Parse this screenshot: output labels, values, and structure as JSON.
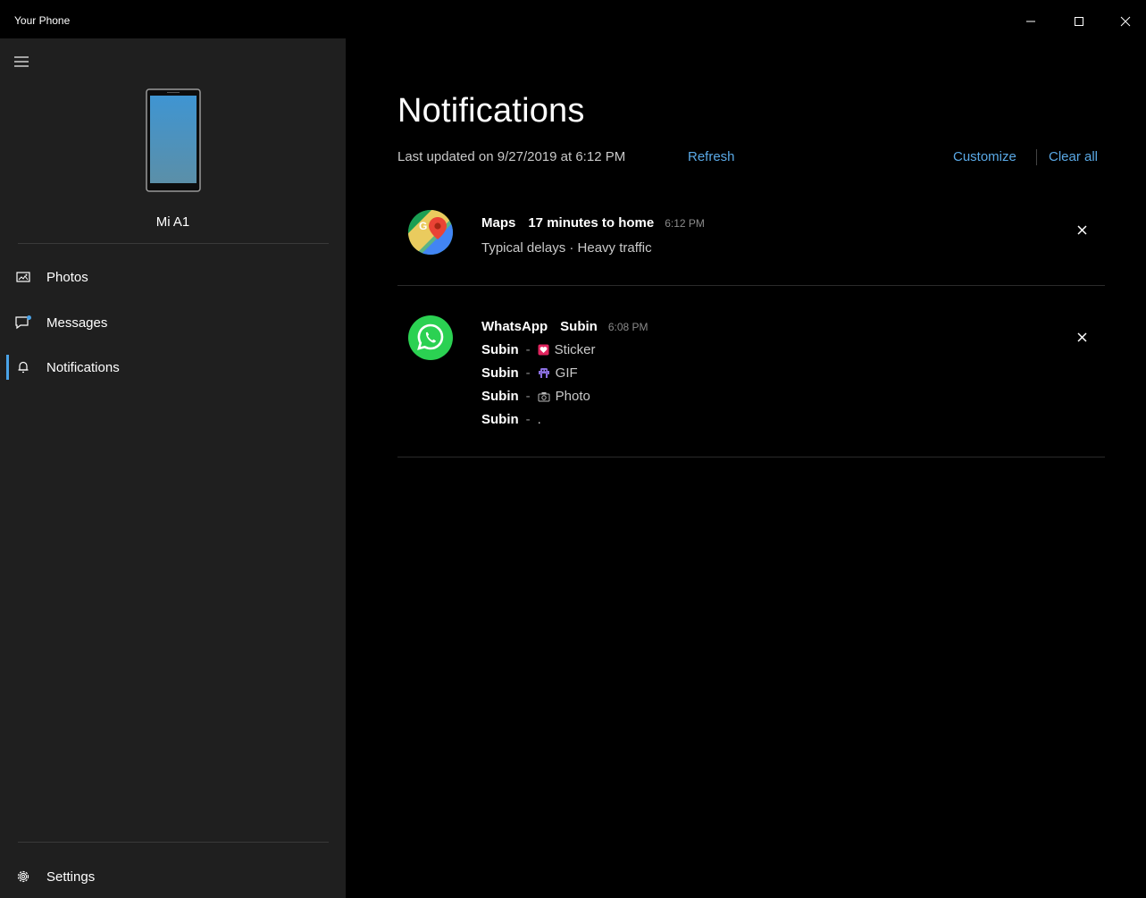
{
  "window": {
    "title": "Your Phone",
    "controls": {
      "minimize": "minimize",
      "maximize": "maximize",
      "close": "close"
    }
  },
  "sidebar": {
    "device_name": "Mi A1",
    "items": [
      {
        "label": "Photos",
        "icon": "photos-icon"
      },
      {
        "label": "Messages",
        "icon": "messages-icon"
      },
      {
        "label": "Notifications",
        "icon": "bell-icon",
        "selected": true
      }
    ],
    "settings_label": "Settings"
  },
  "main": {
    "title": "Notifications",
    "last_updated": "Last updated on 9/27/2019 at 6:12 PM",
    "refresh_label": "Refresh",
    "customize_label": "Customize",
    "clear_all_label": "Clear all",
    "notifications": [
      {
        "app": "Maps",
        "title": "17 minutes to home",
        "time": "6:12 PM",
        "body": "Typical delays · Heavy traffic",
        "icon": "google-maps-icon"
      },
      {
        "app": "WhatsApp",
        "title": "Subin",
        "time": "6:08 PM",
        "icon": "whatsapp-icon",
        "messages": [
          {
            "sender": "Subin",
            "dash": "-",
            "icon": "sticker-icon",
            "text": "Sticker"
          },
          {
            "sender": "Subin",
            "dash": "-",
            "icon": "gif-icon",
            "text": "GIF"
          },
          {
            "sender": "Subin",
            "dash": "-",
            "icon": "camera-icon",
            "text": "Photo"
          },
          {
            "sender": "Subin",
            "dash": "-",
            "icon": "",
            "text": "."
          }
        ]
      }
    ]
  },
  "colors": {
    "accent": "#4aa3e8",
    "link": "#5aa9e6",
    "sidebar_bg": "#1f1f1f",
    "main_bg": "#000000"
  }
}
